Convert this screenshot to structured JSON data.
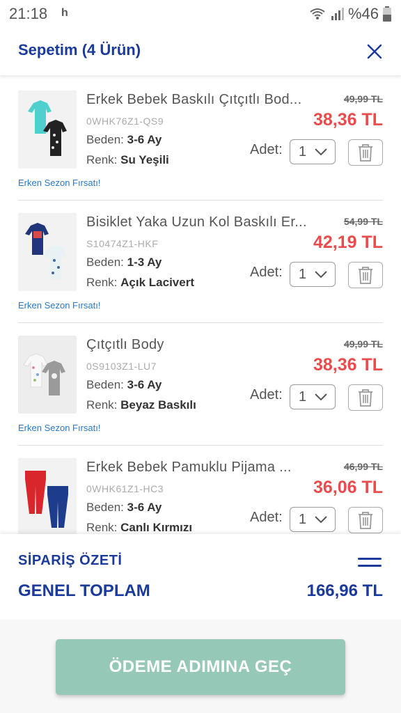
{
  "status_bar": {
    "time": "21:18",
    "notification": "h",
    "battery": "%46",
    "icons": [
      "wifi-icon",
      "signal-icon",
      "battery-icon"
    ]
  },
  "header": {
    "title": "Sepetim (4 Ürün)",
    "close_icon": "close-icon"
  },
  "items": [
    {
      "name": "Erkek Bebek Baskılı Çıtçıtlı Bod...",
      "sku": "0WHK76Z1-QS9",
      "size_label": "Beden:",
      "size": "3-6 Ay",
      "color_label": "Renk:",
      "color": "Su Yeşili",
      "old_price": "49,99 TL",
      "price": "38,36 TL",
      "qty_label": "Adet:",
      "qty": "1",
      "promo": "Erken Sezon Fırsatı!"
    },
    {
      "name": "Bisiklet Yaka Uzun Kol Baskılı Er...",
      "sku": "S10474Z1-HKF",
      "size_label": "Beden:",
      "size": "1-3 Ay",
      "color_label": "Renk:",
      "color": "Açık Lacivert",
      "old_price": "54,99 TL",
      "price": "42,19 TL",
      "qty_label": "Adet:",
      "qty": "1",
      "promo": "Erken Sezon Fırsatı!"
    },
    {
      "name": "Çıtçıtlı Body",
      "sku": "0S9103Z1-LU7",
      "size_label": "Beden:",
      "size": "3-6 Ay",
      "color_label": "Renk:",
      "color": "Beyaz Baskılı",
      "old_price": "49,99 TL",
      "price": "38,36 TL",
      "qty_label": "Adet:",
      "qty": "1",
      "promo": "Erken Sezon Fırsatı!"
    },
    {
      "name": "Erkek Bebek Pamuklu Pijama ...",
      "sku": "0WHK61Z1-HC3",
      "size_label": "Beden:",
      "size": "3-6 Ay",
      "color_label": "Renk:",
      "color": "Canlı Kırmızı",
      "old_price": "46,99 TL",
      "price": "36,06 TL",
      "qty_label": "Adet:",
      "qty": "1",
      "promo": ""
    }
  ],
  "summary": {
    "title": "SİPARİŞ ÖZETİ",
    "total_label": "GENEL TOPLAM",
    "total_value": "166,96 TL"
  },
  "cta": {
    "label": "ÖDEME ADIMINA GEÇ",
    "color": "#95c8b7"
  },
  "colors": {
    "brand_blue": "#1a3a9c",
    "price_red": "#e84c4c",
    "promo_blue": "#2a79c8"
  }
}
